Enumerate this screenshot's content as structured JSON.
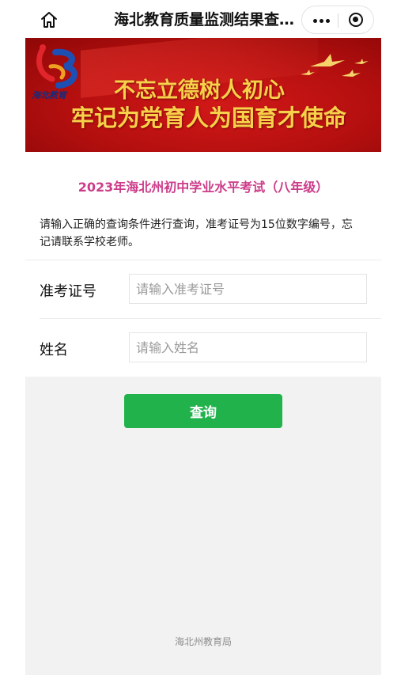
{
  "navbar": {
    "title": "海北教育质量监测结果查…",
    "home_icon": "home-icon",
    "more_icon": "more-dots-icon",
    "close_icon": "mini-program-close-icon"
  },
  "banner": {
    "line1": "不忘立德树人初心",
    "line2": "牢记为党育人为国育才使命",
    "logo_text": "海北教育"
  },
  "exam_title": "2023年海北州初中学业水平考试（八年级）",
  "notice": "请输入正确的查询条件进行查询，准考证号为15位数字编号，忘记请联系学校老师。",
  "form": {
    "exam_no_label": "准考证号",
    "exam_no_placeholder": "请输入准考证号",
    "name_label": "姓名",
    "name_placeholder": "请输入姓名"
  },
  "query_button": "查询",
  "footer": "海北州教育局",
  "colors": {
    "accent": "#21b24c",
    "title_pink": "#cc3c8a",
    "banner_red": "#c01414",
    "banner_gold": "#f7d14a"
  }
}
